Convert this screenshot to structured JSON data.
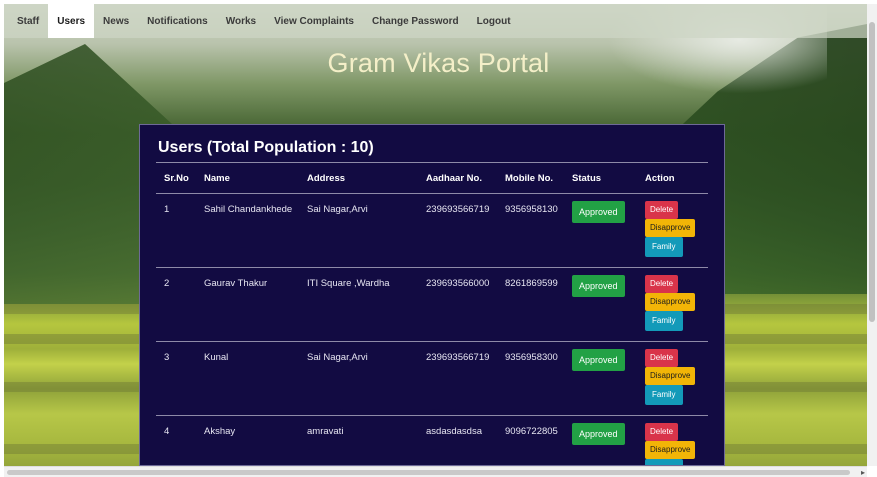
{
  "nav": {
    "items": [
      {
        "label": "Staff"
      },
      {
        "label": "Users"
      },
      {
        "label": "News"
      },
      {
        "label": "Notifications"
      },
      {
        "label": "Works"
      },
      {
        "label": "View Complaints"
      },
      {
        "label": "Change Password"
      },
      {
        "label": "Logout"
      }
    ],
    "active": "Users"
  },
  "header": {
    "title": "Gram Vikas Portal"
  },
  "users_panel": {
    "title": "Users (Total Population : 10)",
    "columns": [
      "Sr.No",
      "Name",
      "Address",
      "Aadhaar No.",
      "Mobile No.",
      "Status",
      "Action"
    ],
    "rows": [
      {
        "sr": "1",
        "name": "Sahil Chandankhede",
        "address": "Sai Nagar,Arvi",
        "aadhaar": "239693566719",
        "mobile": "9356958130",
        "status": "Approved"
      },
      {
        "sr": "2",
        "name": "Gaurav Thakur",
        "address": "ITI Square ,Wardha",
        "aadhaar": "239693566000",
        "mobile": "8261869599",
        "status": "Approved"
      },
      {
        "sr": "3",
        "name": "Kunal",
        "address": "Sai Nagar,Arvi",
        "aadhaar": "239693566719",
        "mobile": "9356958300",
        "status": "Approved"
      },
      {
        "sr": "4",
        "name": "Akshay",
        "address": "amravati",
        "aadhaar": "asdasdasdsa",
        "mobile": "9096722805",
        "status": "Approved"
      }
    ],
    "actions": {
      "delete": "Delete",
      "disapprove": "Disapprove",
      "family": "Family"
    }
  },
  "colors": {
    "panel_bg": "#120b42",
    "approved": "#22a145",
    "delete": "#d9344a",
    "disapprove": "#f2b507",
    "family": "#139ab9",
    "title": "#f4efc8"
  }
}
